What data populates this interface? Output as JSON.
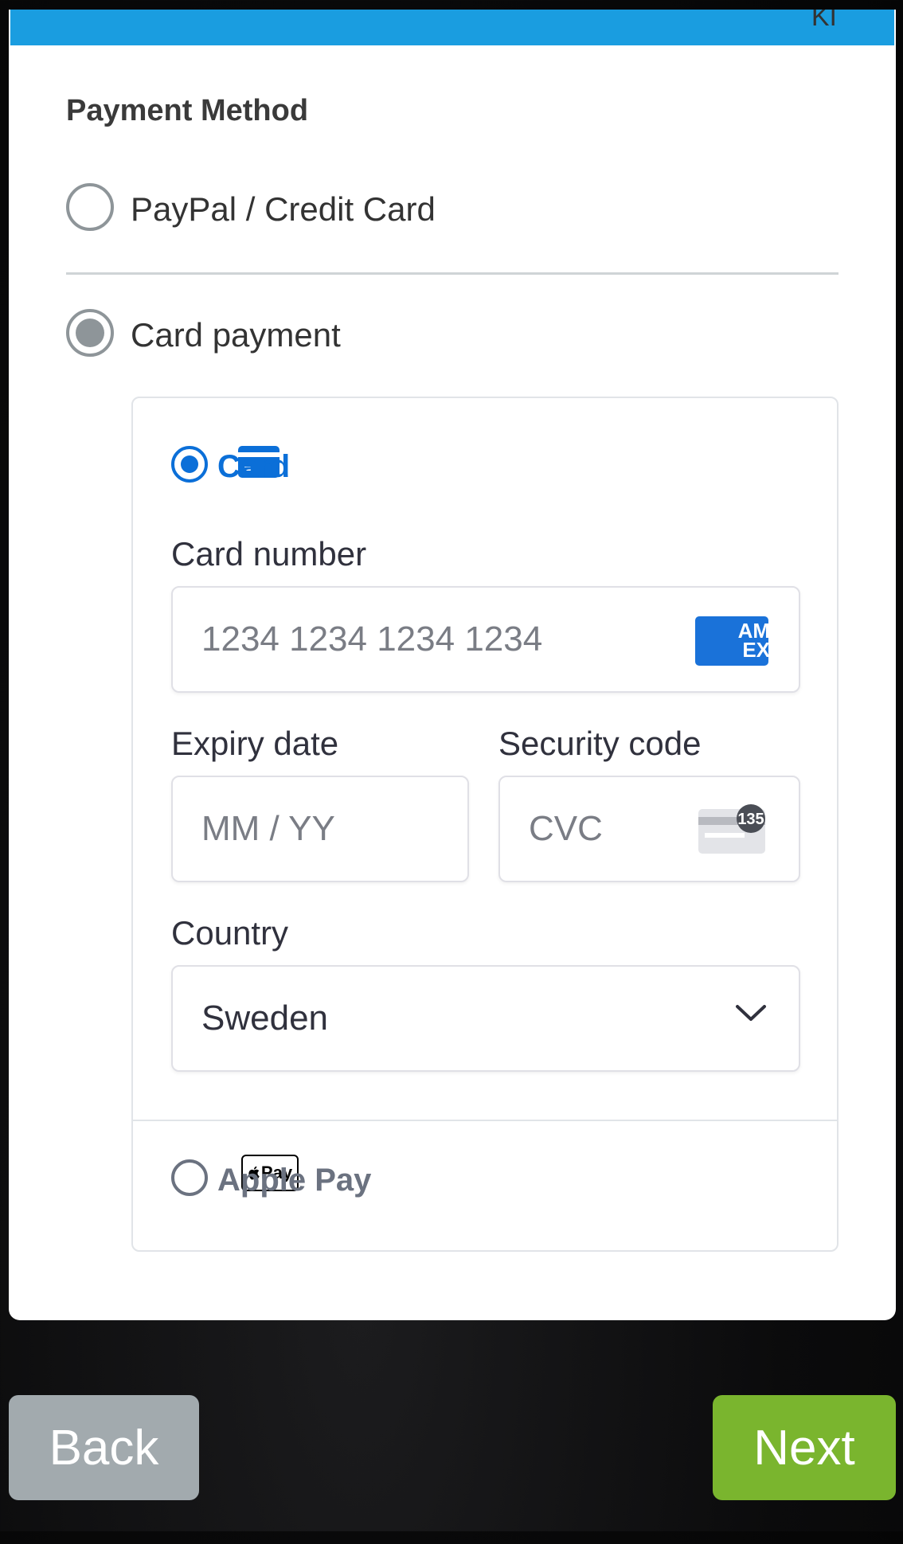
{
  "header": {
    "corner_text": "KI"
  },
  "payment": {
    "title": "Payment Method",
    "options": [
      {
        "label": "PayPal / Credit Card",
        "selected": false
      },
      {
        "label": "Card payment",
        "selected": true
      }
    ]
  },
  "stripe": {
    "tabs": [
      {
        "label": "Card",
        "selected": true,
        "icon": "credit-card-icon"
      },
      {
        "label": "Apple Pay",
        "selected": false,
        "icon": "apple-pay-icon"
      }
    ],
    "card_number": {
      "label": "Card number",
      "placeholder": "1234 1234 1234 1234",
      "brand_icon": "amex-icon",
      "brand_text_1": "AM",
      "brand_text_2": "EX"
    },
    "expiry": {
      "label": "Expiry date",
      "placeholder": "MM / YY"
    },
    "security": {
      "label": "Security code",
      "placeholder": "CVC",
      "icon": "cvc-card-icon",
      "badge": "135"
    },
    "country": {
      "label": "Country",
      "value": "Sweden"
    },
    "apple_pay_badge": "Pay"
  },
  "buttons": {
    "back": "Back",
    "next": "Next"
  },
  "colors": {
    "accent": "#0b6fd8",
    "top_bar": "#1a9de0",
    "next": "#7ab52e",
    "back": "#a2aaae"
  }
}
